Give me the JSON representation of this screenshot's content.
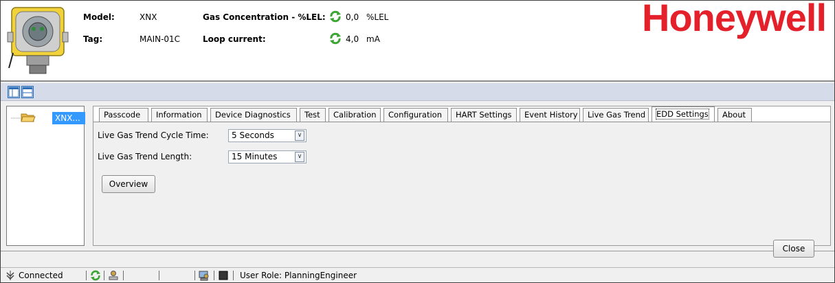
{
  "header": {
    "model_label": "Model:",
    "model_value": "XNX",
    "tag_label": "Tag:",
    "tag_value": "MAIN-01C",
    "gas_label": "Gas Concentration - %LEL:",
    "gas_value": "0,0",
    "gas_unit": "%LEL",
    "loop_label": "Loop current:",
    "loop_value": "4,0",
    "loop_unit": "mA",
    "brand": "Honeywell",
    "brand_color": "#e4202a"
  },
  "tree": {
    "root_label": "XNX..."
  },
  "tabs": [
    {
      "label": "Passcode"
    },
    {
      "label": "Information"
    },
    {
      "label": "Device Diagnostics"
    },
    {
      "label": "Test"
    },
    {
      "label": "Calibration"
    },
    {
      "label": "Configuration"
    },
    {
      "label": "HART Settings"
    },
    {
      "label": "Event History"
    },
    {
      "label": "Live Gas Trend"
    },
    {
      "label": "EDD Settings"
    },
    {
      "label": "About"
    }
  ],
  "active_tab": "EDD Settings",
  "form": {
    "cycle_label": "Live Gas Trend Cycle Time:",
    "cycle_value": "5 Seconds",
    "length_label": "Live Gas Trend Length:",
    "length_value": "15 Minutes",
    "overview_button": "Overview"
  },
  "close_button": "Close",
  "status": {
    "connection": "Connected",
    "user_role": "User Role: PlanningEngineer"
  },
  "icons": {
    "refresh": "refresh-icon",
    "folder": "folder-icon",
    "connected": "connected-icon"
  }
}
